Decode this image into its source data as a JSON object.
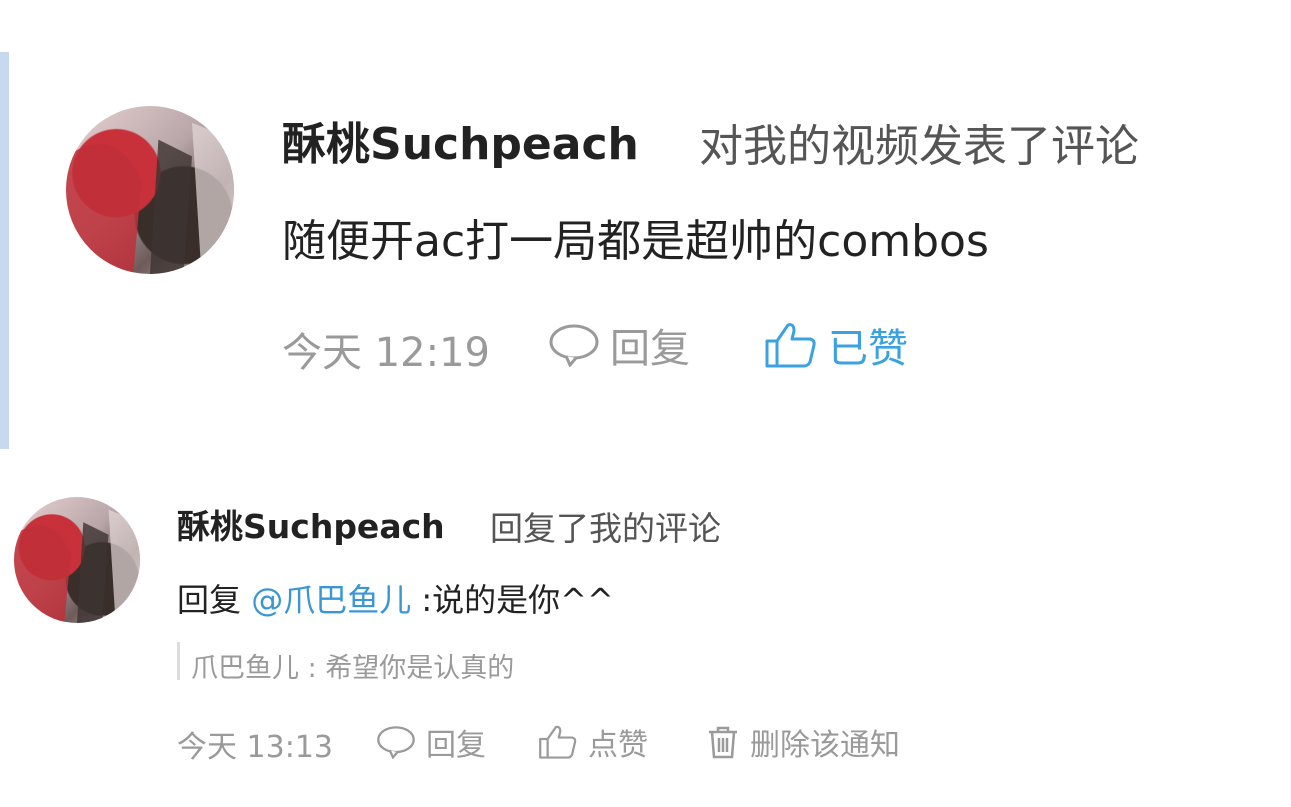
{
  "notification_1": {
    "username": "酥桃Suchpeach",
    "action": "对我的视频发表了评论",
    "comment": "随便开ac打一局都是超帅的combos",
    "time": "今天 12:19",
    "reply_label": "回复",
    "like_label": "已赞",
    "liked": true,
    "accent_color": "#3ba1e0"
  },
  "notification_2": {
    "username": "酥桃Suchpeach",
    "action": "回复了我的评论",
    "reply_prefix": "回复",
    "mention": "@爪巴鱼儿",
    "reply_text": ":说的是你^^",
    "quoted": "爪巴鱼儿 : 希望你是认真的",
    "time": "今天 13:13",
    "reply_label": "回复",
    "like_label": "点赞",
    "delete_label": "删除该通知"
  },
  "icons": {
    "reply": "speech-bubble-icon",
    "like": "thumbs-up-icon",
    "delete": "trash-icon"
  }
}
